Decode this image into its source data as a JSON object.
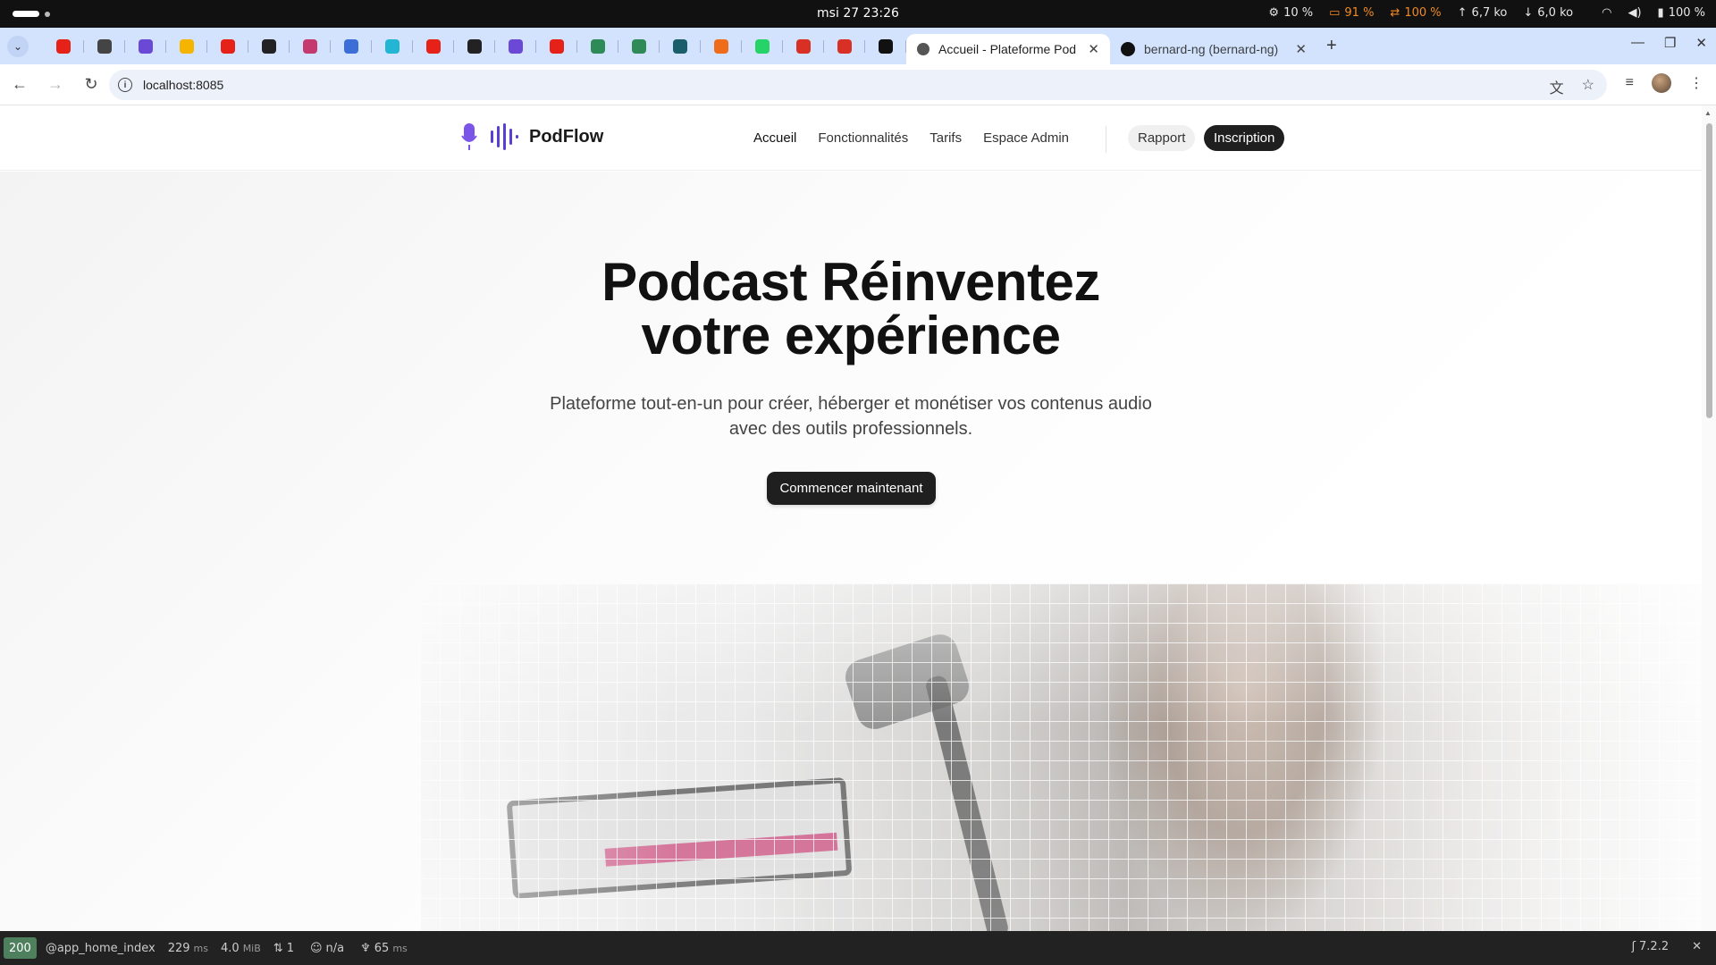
{
  "os": {
    "clock": "msi 27  23:26",
    "indicators": [
      {
        "icon": "cpu-icon",
        "text": "10 %",
        "warn": false
      },
      {
        "icon": "memory-icon",
        "text": "91 %",
        "warn": true
      },
      {
        "icon": "swap-icon",
        "text": "100 %",
        "warn": true
      },
      {
        "icon": "upload-icon",
        "text": "6,7 ko",
        "warn": false
      },
      {
        "icon": "download-icon",
        "text": "6,0 ko",
        "warn": false
      }
    ],
    "battery": "100 %"
  },
  "browser": {
    "pinned_tabs": [
      {
        "icon": "youtube-icon",
        "color": "#e62117"
      },
      {
        "icon": "gitkraken-icon",
        "color": "#444444"
      },
      {
        "icon": "linear-icon",
        "color": "#6b48d6"
      },
      {
        "icon": "google-slides-icon",
        "color": "#f5b400"
      },
      {
        "icon": "youtube-icon",
        "color": "#e62117"
      },
      {
        "icon": "target-icon",
        "color": "#222222"
      },
      {
        "icon": "spiral-icon",
        "color": "#c43a6e"
      },
      {
        "icon": "bird-icon",
        "color": "#3b6ed6"
      },
      {
        "icon": "tailwind-icon",
        "color": "#22b6d4"
      },
      {
        "icon": "youtube-icon",
        "color": "#e62117"
      },
      {
        "icon": "symfony-icon",
        "color": "#222222"
      },
      {
        "icon": "linear-icon",
        "color": "#6b48d6"
      },
      {
        "icon": "youtube-icon",
        "color": "#e62117"
      },
      {
        "icon": "android-icon",
        "color": "#2e8b57"
      },
      {
        "icon": "android-icon",
        "color": "#2e8b57"
      },
      {
        "icon": "vuetify-icon",
        "color": "#1b5e6b"
      },
      {
        "icon": "postman-icon",
        "color": "#ef6c1b"
      },
      {
        "icon": "whatsapp-icon",
        "color": "#25d366"
      },
      {
        "icon": "gmail-icon",
        "color": "#d93025"
      },
      {
        "icon": "gmail-icon",
        "color": "#d93025"
      },
      {
        "icon": "github-icon",
        "color": "#111111"
      }
    ],
    "tabs": [
      {
        "title": "Accueil - Plateforme Pod",
        "active": true
      },
      {
        "title": "bernard-ng (bernard-ng)",
        "active": false
      }
    ],
    "url": "localhost:8085"
  },
  "site": {
    "brand": "PodFlow",
    "nav": [
      "Accueil",
      "Fonctionnalités",
      "Tarifs",
      "Espace Admin"
    ],
    "rapport": "Rapport",
    "inscription": "Inscription",
    "hero_title_line1": "Podcast Réinventez",
    "hero_title_line2": "votre expérience",
    "hero_subtitle": "Plateforme tout-en-un pour créer, héberger et monétiser vos contenus audio avec des outils professionnels.",
    "cta": "Commencer maintenant",
    "brand_color": "#6c4be0"
  },
  "debug": {
    "status": "200",
    "route": "@app_home_index",
    "time": "229",
    "time_unit": "ms",
    "memory": "4.0",
    "memory_unit": "MiB",
    "requests": "1",
    "user": "n/a",
    "render_time": "65",
    "render_unit": "ms",
    "version": "7.2.2"
  }
}
